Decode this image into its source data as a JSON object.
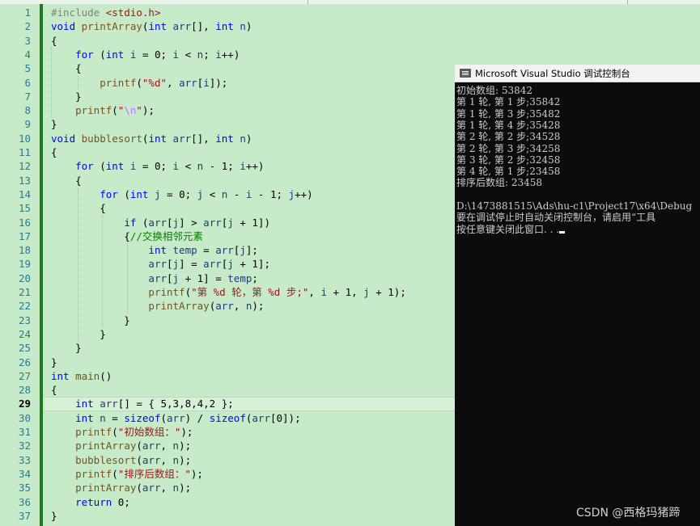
{
  "editor": {
    "current_line": 29,
    "lines": [
      [
        [
          "pp",
          "#include "
        ],
        [
          "str",
          "<stdio.h>"
        ]
      ],
      [
        [
          "kw",
          "void "
        ],
        [
          "fn",
          "printArray"
        ],
        [
          "",
          "("
        ],
        [
          "kw",
          "int "
        ],
        [
          "var",
          "arr"
        ],
        [
          "",
          "[], "
        ],
        [
          "kw",
          "int "
        ],
        [
          "var",
          "n"
        ],
        [
          "",
          ")"
        ]
      ],
      [
        [
          "",
          "{"
        ]
      ],
      [
        [
          "",
          "    "
        ],
        [
          "kw",
          "for "
        ],
        [
          "",
          "("
        ],
        [
          "kw",
          "int "
        ],
        [
          "var",
          "i"
        ],
        [
          "",
          " = 0; "
        ],
        [
          "var",
          "i"
        ],
        [
          "",
          " < "
        ],
        [
          "var",
          "n"
        ],
        [
          "",
          "; "
        ],
        [
          "var",
          "i"
        ],
        [
          "",
          "++)"
        ]
      ],
      [
        [
          "",
          "    {"
        ]
      ],
      [
        [
          "",
          "        "
        ],
        [
          "fn",
          "printf"
        ],
        [
          "",
          "("
        ],
        [
          "str",
          "\"%d\""
        ],
        [
          "",
          ", "
        ],
        [
          "var",
          "arr"
        ],
        [
          "",
          "["
        ],
        [
          "var",
          "i"
        ],
        [
          "",
          "]);"
        ]
      ],
      [
        [
          "",
          "    }"
        ]
      ],
      [
        [
          "",
          "    "
        ],
        [
          "fn",
          "printf"
        ],
        [
          "",
          "("
        ],
        [
          "str",
          "\""
        ],
        [
          "esc",
          "\\n"
        ],
        [
          "str",
          "\""
        ],
        [
          "",
          ");"
        ]
      ],
      [
        [
          "",
          "}"
        ]
      ],
      [
        [
          "kw",
          "void "
        ],
        [
          "fn",
          "bubblesort"
        ],
        [
          "",
          "("
        ],
        [
          "kw",
          "int "
        ],
        [
          "var",
          "arr"
        ],
        [
          "",
          "[], "
        ],
        [
          "kw",
          "int "
        ],
        [
          "var",
          "n"
        ],
        [
          "",
          ")"
        ]
      ],
      [
        [
          "",
          "{"
        ]
      ],
      [
        [
          "",
          "    "
        ],
        [
          "kw",
          "for "
        ],
        [
          "",
          "("
        ],
        [
          "kw",
          "int "
        ],
        [
          "var",
          "i"
        ],
        [
          "",
          " = 0; "
        ],
        [
          "var",
          "i"
        ],
        [
          "",
          " < "
        ],
        [
          "var",
          "n"
        ],
        [
          "",
          " - 1; "
        ],
        [
          "var",
          "i"
        ],
        [
          "",
          "++)"
        ]
      ],
      [
        [
          "",
          "    {"
        ]
      ],
      [
        [
          "",
          "        "
        ],
        [
          "kw",
          "for "
        ],
        [
          "",
          "("
        ],
        [
          "kw",
          "int "
        ],
        [
          "var",
          "j"
        ],
        [
          "",
          " = 0; "
        ],
        [
          "var",
          "j"
        ],
        [
          "",
          " < "
        ],
        [
          "var",
          "n"
        ],
        [
          "",
          " - "
        ],
        [
          "var",
          "i"
        ],
        [
          "",
          " - 1; "
        ],
        [
          "var",
          "j"
        ],
        [
          "",
          "++)"
        ]
      ],
      [
        [
          "",
          "        {"
        ]
      ],
      [
        [
          "",
          "            "
        ],
        [
          "kw",
          "if "
        ],
        [
          "",
          "("
        ],
        [
          "var",
          "arr"
        ],
        [
          "",
          "["
        ],
        [
          "var",
          "j"
        ],
        [
          "",
          "] > "
        ],
        [
          "var",
          "arr"
        ],
        [
          "",
          "["
        ],
        [
          "var",
          "j"
        ],
        [
          "",
          " + 1])"
        ]
      ],
      [
        [
          "",
          "            {"
        ],
        [
          "cm",
          "//交换相邻元素"
        ]
      ],
      [
        [
          "",
          "                "
        ],
        [
          "kw",
          "int "
        ],
        [
          "var",
          "temp"
        ],
        [
          "",
          " = "
        ],
        [
          "var",
          "arr"
        ],
        [
          "",
          "["
        ],
        [
          "var",
          "j"
        ],
        [
          "",
          "];"
        ]
      ],
      [
        [
          "",
          "                "
        ],
        [
          "var",
          "arr"
        ],
        [
          "",
          "["
        ],
        [
          "var",
          "j"
        ],
        [
          "",
          "] = "
        ],
        [
          "var",
          "arr"
        ],
        [
          "",
          "["
        ],
        [
          "var",
          "j"
        ],
        [
          "",
          " + 1];"
        ]
      ],
      [
        [
          "",
          "                "
        ],
        [
          "var",
          "arr"
        ],
        [
          "",
          "["
        ],
        [
          "var",
          "j"
        ],
        [
          "",
          " + 1] = "
        ],
        [
          "var",
          "temp"
        ],
        [
          "",
          ";"
        ]
      ],
      [
        [
          "",
          "                "
        ],
        [
          "fn",
          "printf"
        ],
        [
          "",
          "("
        ],
        [
          "str",
          "\"第 %d 轮，第 %d 步;\""
        ],
        [
          "",
          ", "
        ],
        [
          "var",
          "i"
        ],
        [
          "",
          " + 1, "
        ],
        [
          "var",
          "j"
        ],
        [
          "",
          " + 1);"
        ]
      ],
      [
        [
          "",
          "                "
        ],
        [
          "fn",
          "printArray"
        ],
        [
          "",
          "("
        ],
        [
          "var",
          "arr"
        ],
        [
          "",
          ", "
        ],
        [
          "var",
          "n"
        ],
        [
          "",
          ");"
        ]
      ],
      [
        [
          "",
          "            }"
        ]
      ],
      [
        [
          "",
          "        }"
        ]
      ],
      [
        [
          "",
          "    }"
        ]
      ],
      [
        [
          "",
          "}"
        ]
      ],
      [
        [
          "kw",
          "int "
        ],
        [
          "fn",
          "main"
        ],
        [
          "",
          "()"
        ]
      ],
      [
        [
          "",
          "{"
        ]
      ],
      [
        [
          "",
          "    "
        ],
        [
          "kw",
          "int "
        ],
        [
          "var",
          "arr"
        ],
        [
          "",
          "[] = { 5,3,8,4,2 };"
        ]
      ],
      [
        [
          "",
          "    "
        ],
        [
          "kw",
          "int "
        ],
        [
          "var",
          "n"
        ],
        [
          "",
          " = "
        ],
        [
          "kw",
          "sizeof"
        ],
        [
          "",
          "("
        ],
        [
          "var",
          "arr"
        ],
        [
          "",
          ") / "
        ],
        [
          "kw",
          "sizeof"
        ],
        [
          "",
          "("
        ],
        [
          "var",
          "arr"
        ],
        [
          "",
          "[0]);"
        ]
      ],
      [
        [
          "",
          "    "
        ],
        [
          "fn",
          "printf"
        ],
        [
          "",
          "("
        ],
        [
          "str",
          "\"初始数组：\""
        ],
        [
          "",
          ");"
        ]
      ],
      [
        [
          "",
          "    "
        ],
        [
          "fn",
          "printArray"
        ],
        [
          "",
          "("
        ],
        [
          "var",
          "arr"
        ],
        [
          "",
          ", "
        ],
        [
          "var",
          "n"
        ],
        [
          "",
          ");"
        ]
      ],
      [
        [
          "",
          "    "
        ],
        [
          "fn",
          "bubblesort"
        ],
        [
          "",
          "("
        ],
        [
          "var",
          "arr"
        ],
        [
          "",
          ", "
        ],
        [
          "var",
          "n"
        ],
        [
          "",
          ");"
        ]
      ],
      [
        [
          "",
          "    "
        ],
        [
          "fn",
          "printf"
        ],
        [
          "",
          "("
        ],
        [
          "str",
          "\"排序后数组：\""
        ],
        [
          "",
          ");"
        ]
      ],
      [
        [
          "",
          "    "
        ],
        [
          "fn",
          "printArray"
        ],
        [
          "",
          "("
        ],
        [
          "var",
          "arr"
        ],
        [
          "",
          ", "
        ],
        [
          "var",
          "n"
        ],
        [
          "",
          ");"
        ]
      ],
      [
        [
          "",
          "    "
        ],
        [
          "kw",
          "return "
        ],
        [
          "",
          "0;"
        ]
      ],
      [
        [
          "",
          "}"
        ]
      ]
    ]
  },
  "console": {
    "title": "Microsoft Visual Studio 调试控制台",
    "lines": [
      "初始数组: 53842",
      "第 1 轮, 第 1 步;35842",
      "第 1 轮, 第 3 步;35482",
      "第 1 轮, 第 4 步;35428",
      "第 2 轮, 第 2 步;34528",
      "第 2 轮, 第 3 步;34258",
      "第 3 轮, 第 2 步;32458",
      "第 4 轮, 第 1 步;23458",
      "排序后数组: 23458",
      "",
      "D:\\1473881515\\Ads\\hu-c1\\Project17\\x64\\Debug",
      "要在调试停止时自动关闭控制台，请启用“工具",
      "按任意键关闭此窗口. . ."
    ]
  },
  "watermark": "CSDN @西格玛猪蹄"
}
